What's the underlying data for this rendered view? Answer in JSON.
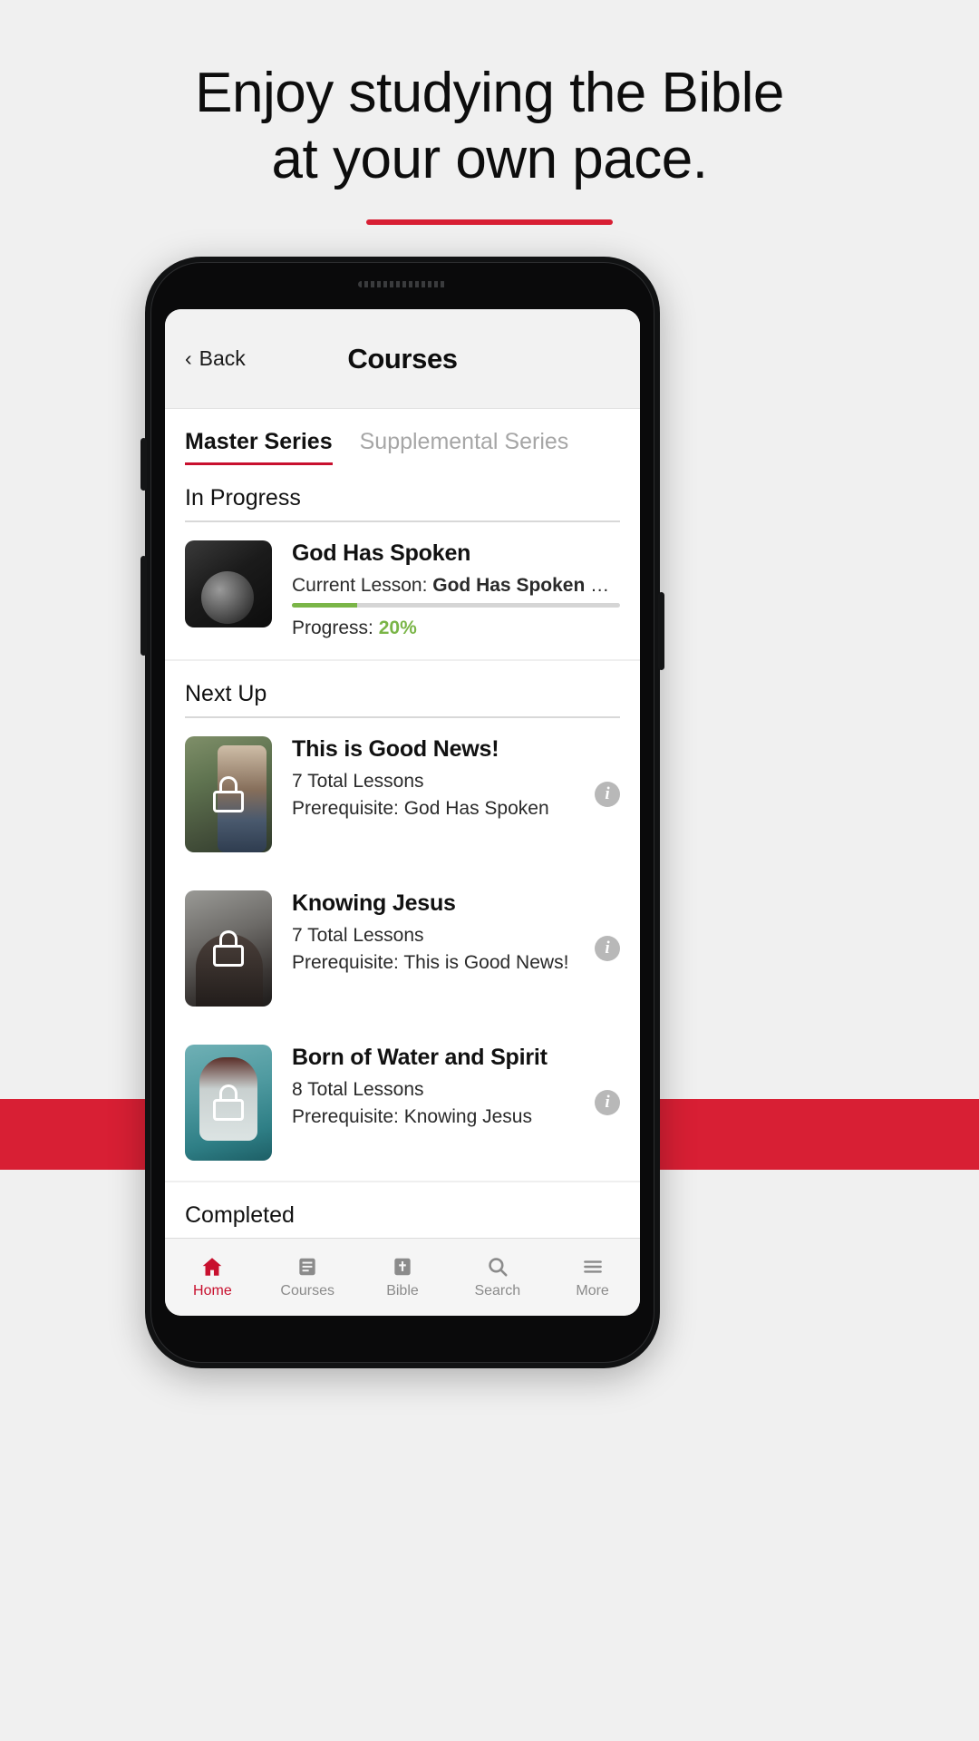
{
  "marketing": {
    "headline_line1": "Enjoy studying the Bible",
    "headline_line2": "at your own pace.",
    "accent_color": "#d81f34"
  },
  "app": {
    "navbar": {
      "back_label": "Back",
      "back_icon": "chevron-left-icon",
      "title": "Courses"
    },
    "tabs": [
      {
        "label": "Master Series",
        "active": true
      },
      {
        "label": "Supplemental Series",
        "active": false
      }
    ],
    "sections": {
      "in_progress": {
        "heading": "In Progress",
        "course": {
          "title": "God Has Spoken",
          "current_lesson_label": "Current Lesson:",
          "current_lesson_value": "God Has Spoken T…",
          "progress_label": "Progress:",
          "progress_value": "20%",
          "progress_percent": 20,
          "progress_color": "#7ab547"
        }
      },
      "next_up": {
        "heading": "Next Up",
        "courses": [
          {
            "title": "This is Good News!",
            "lessons": "7 Total Lessons",
            "prerequisite": "Prerequisite: God Has Spoken",
            "locked": true,
            "lock_icon": "lock-icon",
            "info_icon": "info-icon",
            "info_glyph": "i"
          },
          {
            "title": "Knowing Jesus",
            "lessons": "7 Total Lessons",
            "prerequisite": "Prerequisite: This is Good News!",
            "locked": true,
            "lock_icon": "lock-icon",
            "info_icon": "info-icon",
            "info_glyph": "i"
          },
          {
            "title": "Born of Water and Spirit",
            "lessons": "8 Total Lessons",
            "prerequisite": "Prerequisite: Knowing Jesus",
            "locked": true,
            "lock_icon": "lock-icon",
            "info_icon": "info-icon",
            "info_glyph": "i"
          }
        ]
      },
      "completed": {
        "heading": "Completed"
      }
    },
    "tabbar": [
      {
        "label": "Home",
        "icon": "home-icon",
        "active": true
      },
      {
        "label": "Courses",
        "icon": "book-icon",
        "active": false
      },
      {
        "label": "Bible",
        "icon": "bible-icon",
        "active": false
      },
      {
        "label": "Search",
        "icon": "search-icon",
        "active": false
      },
      {
        "label": "More",
        "icon": "menu-icon",
        "active": false
      }
    ],
    "active_color": "#c8102e"
  }
}
